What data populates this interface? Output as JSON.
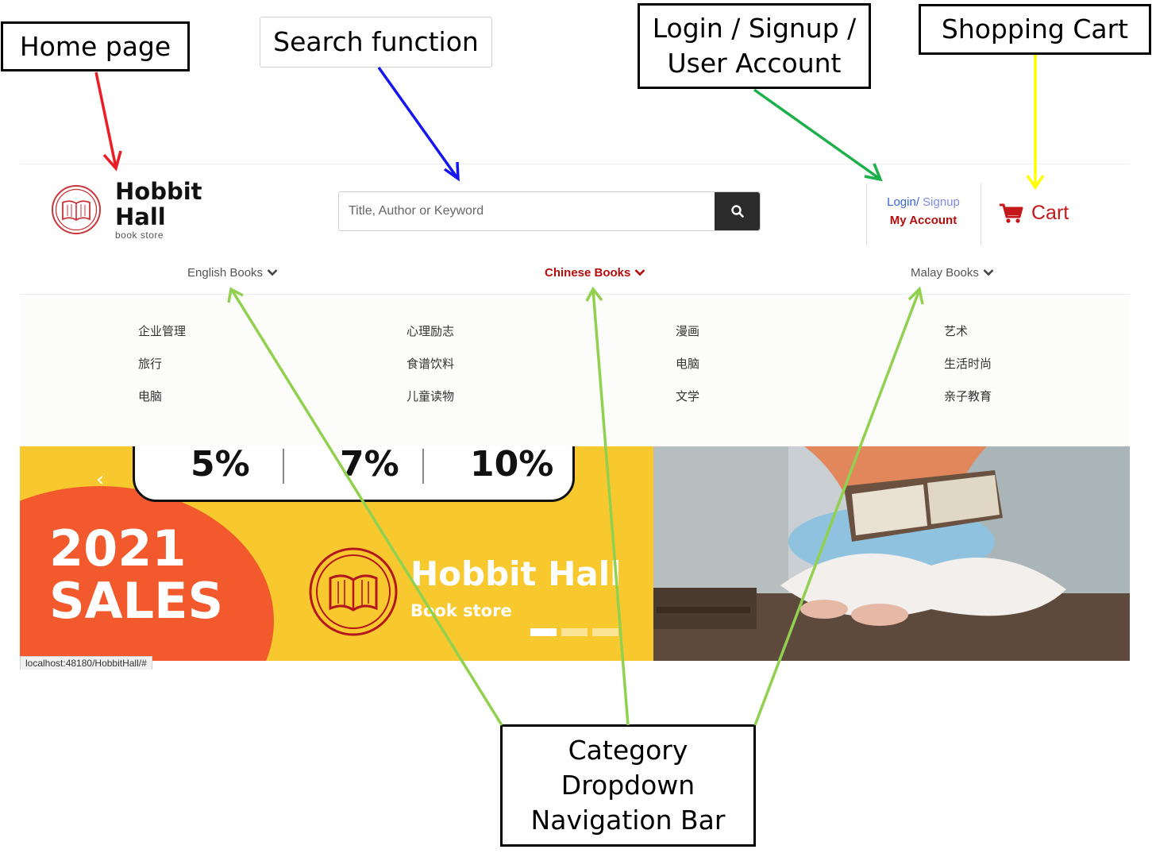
{
  "annotations": {
    "home_page": "Home page",
    "search_function": "Search function",
    "login_line1": "Login / Signup /",
    "login_line2": "User Account",
    "shopping_cart": "Shopping Cart",
    "category_line1": "Category",
    "category_line2": "Dropdown",
    "category_line3": "Navigation Bar"
  },
  "header": {
    "logo_line1": "Hobbit",
    "logo_line2": "Hall",
    "logo_sub": "book store",
    "search_placeholder": "Title, Author or Keyword",
    "login_label": "Login/",
    "signup_label": " Signup",
    "my_account": "My Account",
    "cart_label": "Cart"
  },
  "nav": {
    "english": "English Books",
    "chinese": "Chinese Books",
    "malay": "Malay Books"
  },
  "dropdown": {
    "items": [
      "企业管理",
      "心理励志",
      "漫画",
      "艺术",
      "旅行",
      "食谱饮料",
      "电脑",
      "生活时尚",
      "电脑",
      "儿童读物",
      "文学",
      "亲子教育"
    ]
  },
  "banner": {
    "pct_1": "5%",
    "pct_2": "7%",
    "pct_3": "10%",
    "sales_year": "2021",
    "sales_word": "SALES",
    "brand_name": "Hobbit Hall",
    "brand_sub": "Book store",
    "slide_count": 3,
    "active_slide": 1
  },
  "status_url": "localhost:48180/HobbitHall/#",
  "colors": {
    "home_arrow": "#ec1c24",
    "search_arrow": "#1515f0",
    "login_arrow": "#1db04b",
    "cart_arrow": "#ffff00",
    "category_arrow": "#92d050",
    "brand_red": "#b50d0d",
    "banner_yellow": "#f8c92e",
    "banner_orange": "#f2592d"
  }
}
